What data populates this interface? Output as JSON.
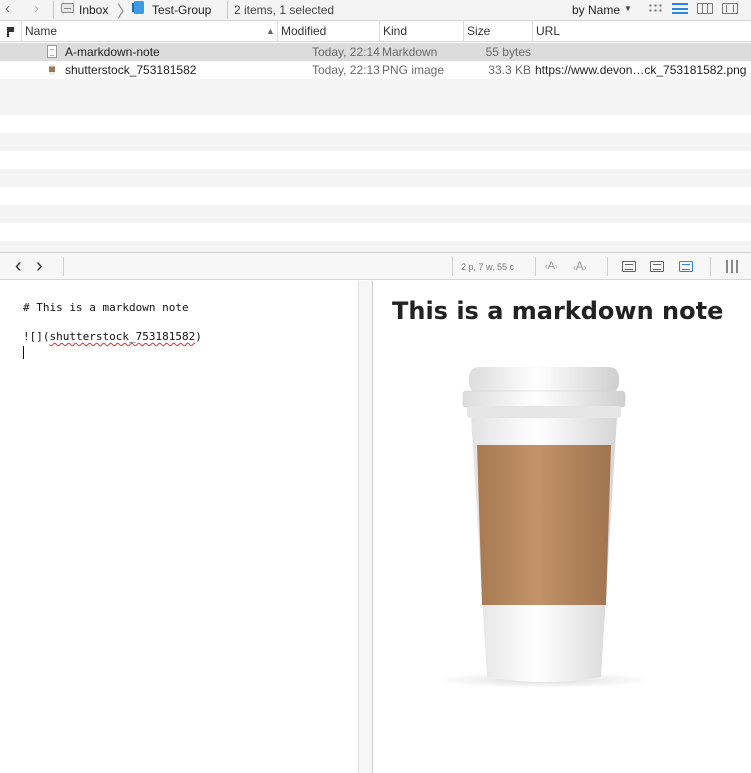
{
  "pathbar": {
    "back_icon": "chevron-left-icon",
    "forward_icon": "chevron-right-icon",
    "crumbs": [
      {
        "label": "Inbox",
        "icon": "inbox-icon"
      },
      {
        "label": "Test-Group",
        "icon": "group-icon"
      }
    ],
    "status": "2 items, 1 selected",
    "sort_label": "by Name",
    "views": [
      "icon-view",
      "list-view",
      "column-view",
      "cover-flow-view"
    ],
    "active_view": "list-view"
  },
  "table": {
    "columns": [
      "Name",
      "Modified",
      "Kind",
      "Size",
      "URL"
    ],
    "sort_column": "Name",
    "rows": [
      {
        "name": "A-markdown-note",
        "modified": "Today, 22:14",
        "kind": "Markdown",
        "size": "55 bytes",
        "url": "",
        "icon": "markdown-doc-icon",
        "selected": true
      },
      {
        "name": "shutterstock_753181582",
        "modified": "Today, 22:13",
        "kind": "PNG image",
        "size": "33.3 KB",
        "url": "https://www.devon…ck_753181582.png",
        "icon": "png-image-icon",
        "selected": false
      }
    ]
  },
  "editor_toolbar": {
    "stats": "2 p, 7 w, 55 c",
    "font_smaller": "A",
    "font_larger": "A"
  },
  "editor": {
    "lines": [
      "# This is a markdown note",
      "![](shutterstock_753181582)"
    ],
    "link_prefix": "![](",
    "link_target": "shutterstock_753181582",
    "link_suffix": ")"
  },
  "preview": {
    "heading": "This is a markdown note",
    "image": "coffee-cup-image"
  },
  "colors": {
    "accent": "#2b86e3",
    "selection": "#dcdcdc",
    "sleeve": "#b8875c"
  }
}
